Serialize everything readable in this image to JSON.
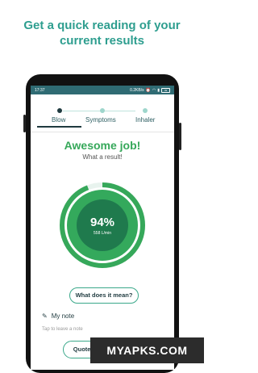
{
  "headline": {
    "line1": "Get a quick reading of your",
    "line2": "current results"
  },
  "status_bar": {
    "time": "17:37",
    "speed": "0.2KB/s",
    "battery": "49"
  },
  "stepper": {
    "steps": [
      {
        "label": "Blow",
        "active": true
      },
      {
        "label": "Symptoms",
        "active": false
      },
      {
        "label": "Inhaler",
        "active": false
      }
    ]
  },
  "result": {
    "title": "Awesome job!",
    "subtitle": "What a result!",
    "percent_text": "94%",
    "percent_value": 94,
    "flow_text": "558 L/min"
  },
  "actions": {
    "meaning_label": "What does it mean?",
    "note_label": "My note",
    "note_placeholder": "Tap to leave a note",
    "quote_label": "Quote of the..."
  },
  "watermark": "MYAPKS.COM",
  "colors": {
    "accent": "#2e9e8f",
    "success": "#36a85a",
    "gauge_dark": "#1f7a4d",
    "status_bar": "#2f6b73"
  }
}
